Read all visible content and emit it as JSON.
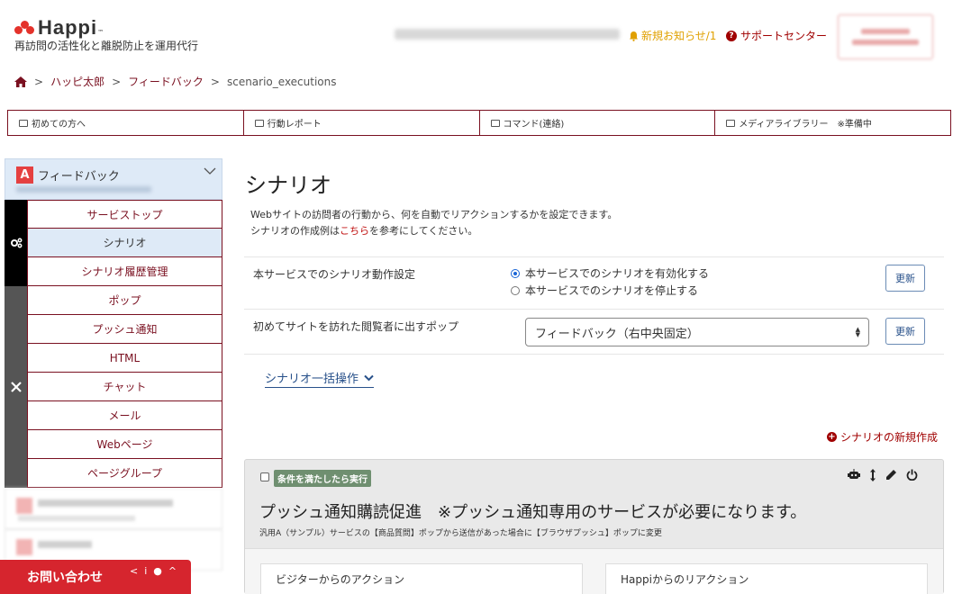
{
  "brand": {
    "name": "Happi",
    "tm": "™",
    "tagline": "再訪問の活性化と離脱防止を運用代行"
  },
  "header": {
    "notice": "新規お知らせ/1",
    "support": "サポートセンター"
  },
  "breadcrumb": {
    "items": [
      "ハッピ太郎",
      "フィードバック",
      "scenario_executions"
    ],
    "sep": ">"
  },
  "topnav": {
    "items": [
      "初めての方へ",
      "行動レポート",
      "コマンド(連絡)",
      "メディアライブラリー　※準備中"
    ]
  },
  "sidebar": {
    "head_badge": "A",
    "head_title": "フィードバック",
    "group1": [
      "サービストップ",
      "シナリオ",
      "シナリオ履歴管理"
    ],
    "group2": [
      "ポップ",
      "プッシュ通知",
      "HTML",
      "チャット",
      "メール",
      "Webページ",
      "ページグループ"
    ],
    "active": "シナリオ"
  },
  "contact": {
    "label": "お問い合わせ"
  },
  "main": {
    "title": "シナリオ",
    "desc_line1": "Webサイトの訪問者の行動から、何を自動でリアクションするかを設定できます。",
    "desc_line2_pre": "シナリオの作成例は",
    "desc_line2_link": "こちら",
    "desc_line2_post": "を参考にしてください。",
    "setting1": {
      "label": "本サービスでのシナリオ動作設定",
      "option_on": "本サービスでのシナリオを有効化する",
      "option_off": "本サービスでのシナリオを停止する",
      "selected": "on",
      "button": "更新"
    },
    "setting2": {
      "label": "初めてサイトを訪れた閲覧者に出すポップ",
      "select_value": "フィードバック（右中央固定）",
      "button": "更新"
    },
    "bulk_label": "シナリオ一括操作",
    "new_scenario": "シナリオの新規作成"
  },
  "card": {
    "badge": "条件を満たしたら実行",
    "title": "プッシュ通知購読促進　※プッシュ通知専用のサービスが必要になります。",
    "desc": "汎用A（サンプル）サービスの【商品質問】ポップから送信があった場合に【ブラウザプッシュ】ポップに変更",
    "left_header": "ビジターからのアクション",
    "right_header": "Happiからのリアクション"
  },
  "colors": {
    "brand_red": "#e4322b",
    "maroon": "#7a1020",
    "active_bg": "#deeaf7",
    "contact_red": "#d6252e"
  }
}
